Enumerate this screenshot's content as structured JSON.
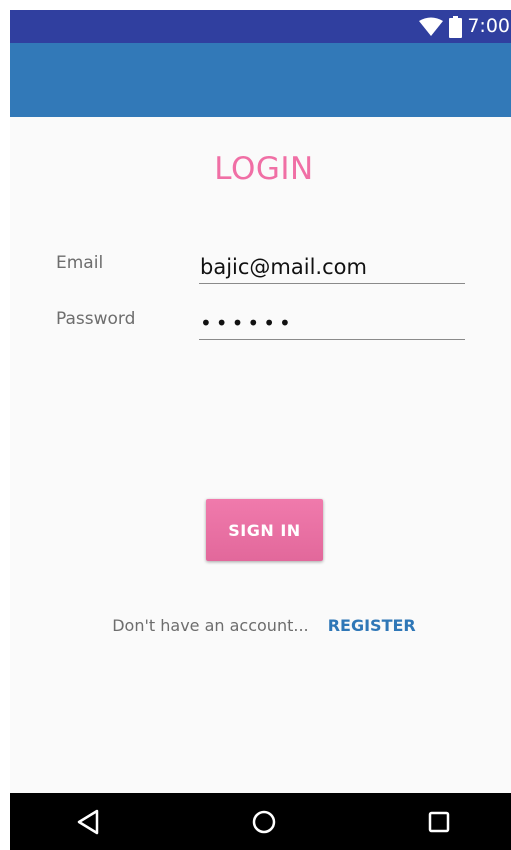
{
  "status_bar": {
    "time": "7:00",
    "icons": [
      "wifi-icon",
      "battery-icon"
    ],
    "color": "#303f9f"
  },
  "app_bar": {
    "color": "#3279b8"
  },
  "login": {
    "title": "LOGIN",
    "email_label": "Email",
    "email_value": "bajic@mail.com",
    "password_label": "Password",
    "password_value": "••••••",
    "sign_in_label": "SIGN IN",
    "register_prompt": "Don't have an account...",
    "register_label": "REGISTER",
    "accent_color": "#f06fa5",
    "link_color": "#2f77b7"
  },
  "nav_bar": {
    "buttons": [
      "back-icon",
      "home-icon",
      "recents-icon"
    ]
  }
}
